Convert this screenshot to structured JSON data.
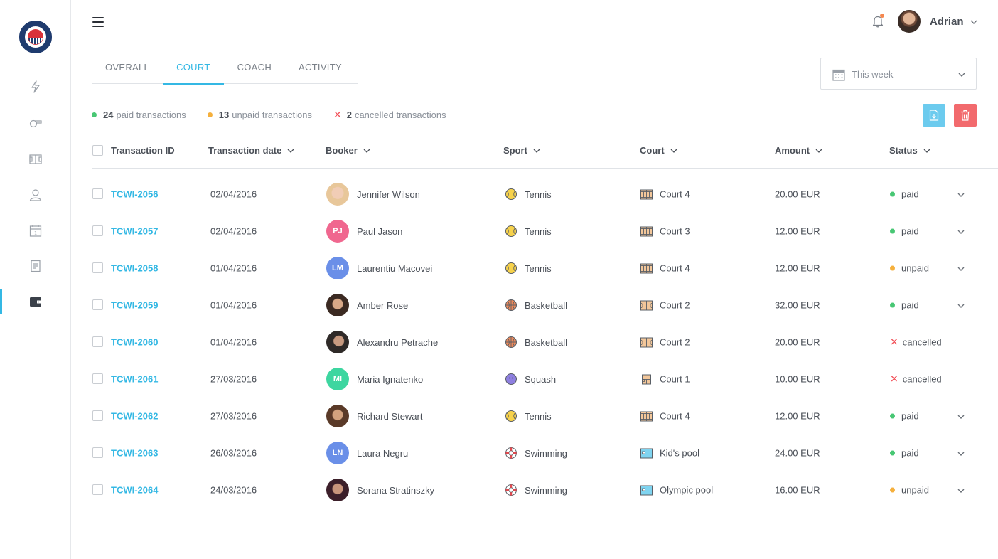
{
  "app": {
    "logo_text": "ROSTREVOR TENNIS CLUB",
    "user_name": "Adrian"
  },
  "tabs": [
    {
      "label": "OVERALL"
    },
    {
      "label": "COURT"
    },
    {
      "label": "COACH"
    },
    {
      "label": "ACTIVITY"
    }
  ],
  "date_filter": {
    "value": "This week"
  },
  "summary": {
    "paid_count": "24",
    "paid_label": "paid transactions",
    "unpaid_count": "13",
    "unpaid_label": "unpaid transactions",
    "cancelled_count": "2",
    "cancelled_label": "cancelled transactions"
  },
  "columns": {
    "id": "Transaction ID",
    "date": "Transaction date",
    "booker": "Booker",
    "sport": "Sport",
    "court": "Court",
    "amount": "Amount",
    "status": "Status"
  },
  "colors": {
    "accent": "#34b8e4",
    "paid": "#48c774",
    "unpaid": "#f5b03d",
    "cancelled": "#f2525a"
  },
  "rows": [
    {
      "id": "TCWI-2056",
      "date": "02/04/2016",
      "booker": "Jennifer Wilson",
      "initials": "",
      "sport": "Tennis",
      "court": "Court 4",
      "amount": "20.00 EUR",
      "status": "paid"
    },
    {
      "id": "TCWI-2057",
      "date": "02/04/2016",
      "booker": "Paul Jason",
      "initials": "PJ",
      "sport": "Tennis",
      "court": "Court 3",
      "amount": "12.00 EUR",
      "status": "paid"
    },
    {
      "id": "TCWI-2058",
      "date": "01/04/2016",
      "booker": "Laurentiu Macovei",
      "initials": "LM",
      "sport": "Tennis",
      "court": "Court 4",
      "amount": "12.00 EUR",
      "status": "unpaid"
    },
    {
      "id": "TCWI-2059",
      "date": "01/04/2016",
      "booker": "Amber Rose",
      "initials": "",
      "sport": "Basketball",
      "court": "Court 2",
      "amount": "32.00 EUR",
      "status": "paid"
    },
    {
      "id": "TCWI-2060",
      "date": "01/04/2016",
      "booker": "Alexandru Petrache",
      "initials": "",
      "sport": "Basketball",
      "court": "Court 2",
      "amount": "20.00 EUR",
      "status": "cancelled"
    },
    {
      "id": "TCWI-2061",
      "date": "27/03/2016",
      "booker": "Maria Ignatenko",
      "initials": "MI",
      "sport": "Squash",
      "court": "Court 1",
      "amount": "10.00 EUR",
      "status": "cancelled"
    },
    {
      "id": "TCWI-2062",
      "date": "27/03/2016",
      "booker": "Richard Stewart",
      "initials": "",
      "sport": "Tennis",
      "court": "Court 4",
      "amount": "12.00 EUR",
      "status": "paid"
    },
    {
      "id": "TCWI-2063",
      "date": "26/03/2016",
      "booker": "Laura Negru",
      "initials": "LN",
      "sport": "Swimming",
      "court": "Kid's pool",
      "amount": "24.00 EUR",
      "status": "paid"
    },
    {
      "id": "TCWI-2064",
      "date": "24/03/2016",
      "booker": "Sorana Stratinszky",
      "initials": "",
      "sport": "Swimming",
      "court": "Olympic pool",
      "amount": "16.00 EUR",
      "status": "unpaid"
    }
  ]
}
